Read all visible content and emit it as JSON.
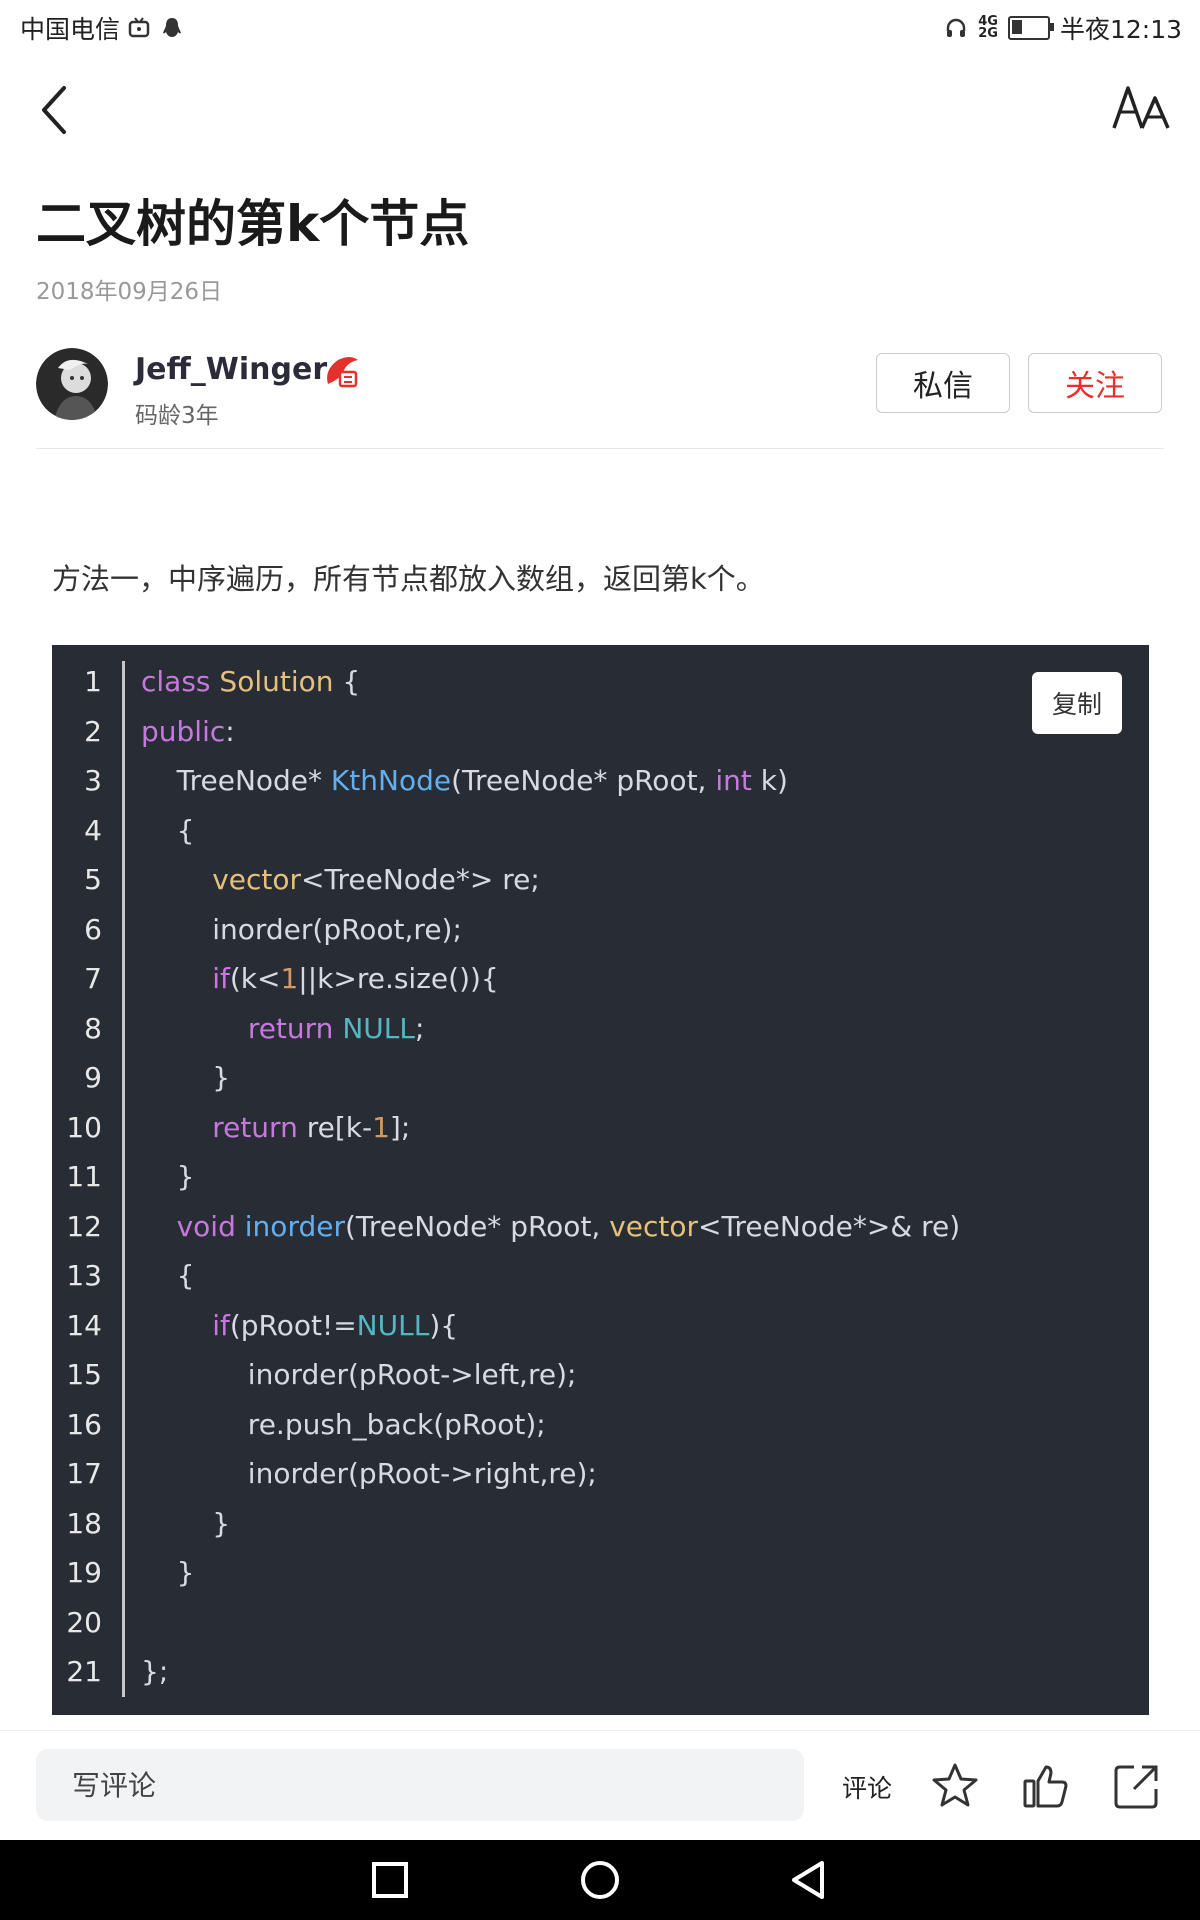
{
  "status_bar": {
    "carrier": "中国电信",
    "network": "4G",
    "network2": "2G",
    "time_label": "半夜12:13",
    "battery_level": 0.3
  },
  "article": {
    "title": "二叉树的第k个节点",
    "date": "2018年09月26日",
    "author": {
      "name": "Jeff_Winger",
      "subtitle": "码龄3年"
    },
    "message_button": "私信",
    "follow_button": "关注",
    "intro": "方法一，中序遍历，所有节点都放入数组，返回第k个。"
  },
  "code_block": {
    "copy_button": "复制",
    "colors": {
      "background": "#282c34",
      "keyword": "#c678dd",
      "type": "#e5c07b",
      "function": "#61afef",
      "null": "#56b6c2",
      "number": "#d19a66",
      "plain": "#d7dae0"
    },
    "lines": [
      [
        [
          "class ",
          "k"
        ],
        [
          "Solution",
          "t"
        ],
        [
          " {",
          ""
        ]
      ],
      [
        [
          "public",
          "k"
        ],
        [
          ":",
          ""
        ]
      ],
      [
        [
          "    TreeNode* ",
          ""
        ],
        [
          "KthNode",
          "f"
        ],
        [
          "(TreeNode* pRoot, ",
          ""
        ],
        [
          "int",
          "k"
        ],
        [
          " k)",
          ""
        ]
      ],
      [
        [
          "    {",
          ""
        ]
      ],
      [
        [
          "        ",
          ""
        ],
        [
          "vector",
          "t"
        ],
        [
          "<TreeNode*> re;",
          ""
        ]
      ],
      [
        [
          "        inorder(pRoot,re);",
          ""
        ]
      ],
      [
        [
          "        ",
          ""
        ],
        [
          "if",
          "k"
        ],
        [
          "(k<",
          ""
        ],
        [
          "1",
          "num"
        ],
        [
          "||k>re.size()){",
          ""
        ]
      ],
      [
        [
          "            ",
          ""
        ],
        [
          "return",
          "k"
        ],
        [
          " ",
          ""
        ],
        [
          "NULL",
          "n"
        ],
        [
          ";",
          ""
        ]
      ],
      [
        [
          "        }",
          ""
        ]
      ],
      [
        [
          "        ",
          ""
        ],
        [
          "return",
          "k"
        ],
        [
          " re[k-",
          ""
        ],
        [
          "1",
          "num"
        ],
        [
          "];",
          ""
        ]
      ],
      [
        [
          "    }",
          ""
        ]
      ],
      [
        [
          "    ",
          ""
        ],
        [
          "void",
          "k"
        ],
        [
          " ",
          ""
        ],
        [
          "inorder",
          "f"
        ],
        [
          "(TreeNode* pRoot, ",
          ""
        ],
        [
          "vector",
          "t"
        ],
        [
          "<TreeNode*>& re)",
          ""
        ]
      ],
      [
        [
          "    {",
          ""
        ]
      ],
      [
        [
          "        ",
          ""
        ],
        [
          "if",
          "k"
        ],
        [
          "(pRoot!=",
          ""
        ],
        [
          "NULL",
          "n"
        ],
        [
          "){",
          ""
        ]
      ],
      [
        [
          "            inorder(pRoot->left,re);",
          ""
        ]
      ],
      [
        [
          "            re.push_back(pRoot);",
          ""
        ]
      ],
      [
        [
          "            inorder(pRoot->right,re);",
          ""
        ]
      ],
      [
        [
          "        }",
          ""
        ]
      ],
      [
        [
          "    }",
          ""
        ]
      ],
      [
        [
          "",
          ""
        ]
      ],
      [
        [
          "};",
          ""
        ]
      ]
    ]
  },
  "bottom_bar": {
    "comment_placeholder": "写评论",
    "comment_label": "评论",
    "icons": [
      "star-icon",
      "thumbs-up-icon",
      "share-icon"
    ]
  },
  "system_nav": {
    "icons": [
      "recent-apps-icon",
      "home-icon",
      "back-triangle-icon"
    ]
  }
}
